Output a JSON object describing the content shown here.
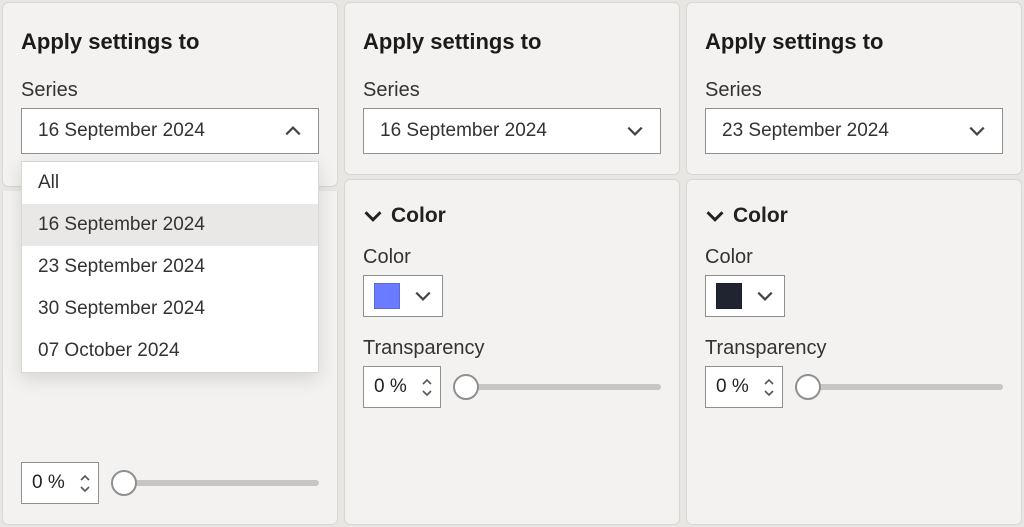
{
  "panels": [
    {
      "title": "Apply settings to",
      "series_label": "Series",
      "series_value": "16 September 2024",
      "dropdown_open": true,
      "options": [
        "All",
        "16 September 2024",
        "23 September 2024",
        "30 September 2024",
        "07 October 2024"
      ],
      "selected_option_index": 1,
      "transparency_value": "0 %"
    },
    {
      "title": "Apply settings to",
      "series_label": "Series",
      "series_value": "16 September 2024",
      "color_section_title": "Color",
      "color_label": "Color",
      "color_swatch": "#6b7bff",
      "transparency_label": "Transparency",
      "transparency_value": "0 %"
    },
    {
      "title": "Apply settings to",
      "series_label": "Series",
      "series_value": "23 September 2024",
      "color_section_title": "Color",
      "color_label": "Color",
      "color_swatch": "#1f2430",
      "transparency_label": "Transparency",
      "transparency_value": "0 %"
    }
  ]
}
